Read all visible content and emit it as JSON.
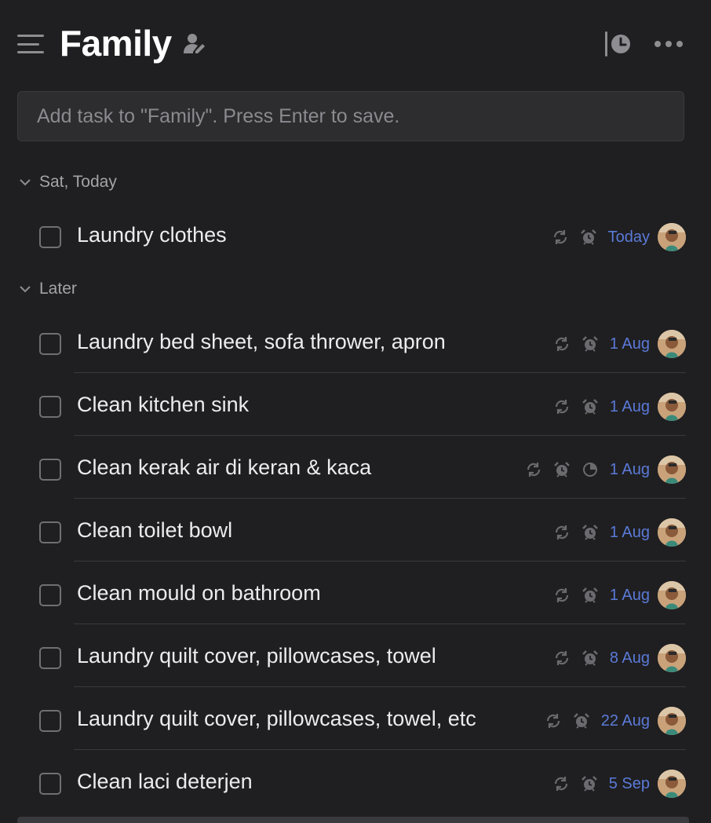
{
  "header": {
    "title": "Family"
  },
  "add_task": {
    "placeholder": "Add task to \"Family\". Press Enter to save."
  },
  "sections": [
    {
      "label": "Sat, Today",
      "tasks": [
        {
          "title": "Laundry clothes",
          "date": "Today",
          "has_duration": false
        }
      ]
    },
    {
      "label": "Later",
      "tasks": [
        {
          "title": "Laundry bed sheet, sofa thrower, apron",
          "date": "1 Aug",
          "has_duration": false
        },
        {
          "title": "Clean kitchen sink",
          "date": "1 Aug",
          "has_duration": false
        },
        {
          "title": "Clean kerak air di keran & kaca",
          "date": "1 Aug",
          "has_duration": true
        },
        {
          "title": "Clean toilet bowl",
          "date": "1 Aug",
          "has_duration": false
        },
        {
          "title": "Clean mould on bathroom",
          "date": "1 Aug",
          "has_duration": false
        },
        {
          "title": "Laundry quilt cover, pillowcases, towel",
          "date": "8 Aug",
          "has_duration": false
        },
        {
          "title": "Laundry quilt cover, pillowcases, towel, etc",
          "date": "22 Aug",
          "has_duration": false
        },
        {
          "title": "Clean laci deterjen",
          "date": "5 Sep",
          "has_duration": false
        }
      ]
    }
  ],
  "icons": {
    "menu": "menu-icon",
    "share": "share-members-icon",
    "history": "history-clock-icon",
    "more": "more-horizontal-icon",
    "repeat": "repeat-icon",
    "reminder": "alarm-icon",
    "duration": "pie-clock-icon"
  },
  "colors": {
    "background": "#1f1f21",
    "input_bg": "#2d2d30",
    "date_accent": "#5b7ad8"
  }
}
